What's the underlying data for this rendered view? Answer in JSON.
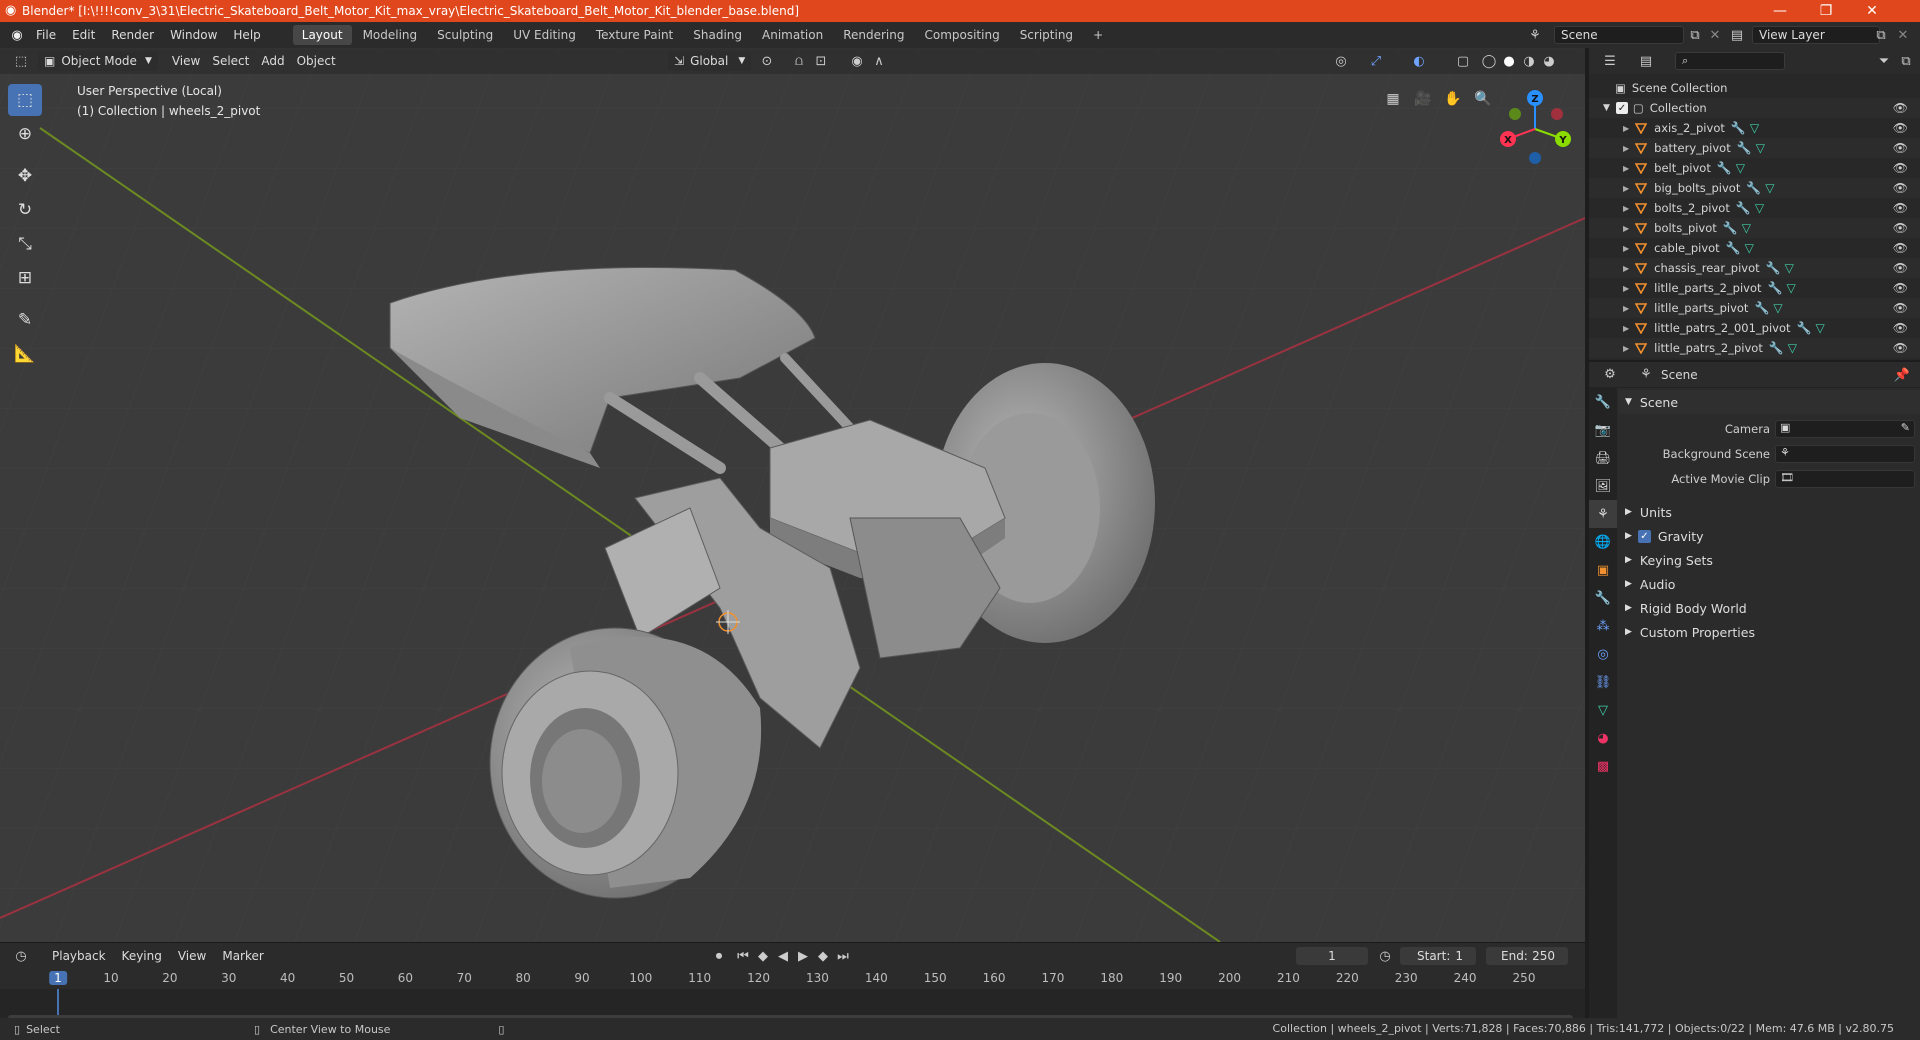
{
  "window": {
    "title": "Blender* [I:\\!!!!conv_3\\31\\Electric_Skateboard_Belt_Motor_Kit_max_vray\\Electric_Skateboard_Belt_Motor_Kit_blender_base.blend]",
    "minimize": "—",
    "maximize": "❐",
    "close": "✕"
  },
  "menu": [
    "File",
    "Edit",
    "Render",
    "Window",
    "Help"
  ],
  "workspaces": [
    "Layout",
    "Modeling",
    "Sculpting",
    "UV Editing",
    "Texture Paint",
    "Shading",
    "Animation",
    "Rendering",
    "Compositing",
    "Scripting"
  ],
  "workspace_add": "+",
  "scene_field": "Scene",
  "view_layer_field": "View Layer",
  "viewport": {
    "mode": "Object Mode",
    "header_menus": [
      "View",
      "Select",
      "Add",
      "Object"
    ],
    "transform_orientation": "Global",
    "info_line1": "User Perspective (Local)",
    "info_line2": "(1) Collection | wheels_2_pivot",
    "gizmo": {
      "z": "Z",
      "y": "Y",
      "x": "X"
    }
  },
  "outliner": {
    "root": "Scene Collection",
    "collection": "Collection",
    "items": [
      "axis_2_pivot",
      "battery_pivot",
      "belt_pivot",
      "big_bolts_pivot",
      "bolts_2_pivot",
      "bolts_pivot",
      "cable_pivot",
      "chassis_rear_pivot",
      "litlle_parts_2_pivot",
      "litlle_parts_pivot",
      "little_patrs_2_001_pivot",
      "little_patrs_2_pivot"
    ]
  },
  "properties": {
    "context": "Scene",
    "panel": "Scene",
    "fields": [
      {
        "label": "Camera"
      },
      {
        "label": "Background Scene"
      },
      {
        "label": "Active Movie Clip"
      }
    ],
    "subpanels": [
      "Units",
      "Gravity",
      "Keying Sets",
      "Audio",
      "Rigid Body World",
      "Custom Properties"
    ],
    "gravity_checked": true
  },
  "timeline": {
    "menus": [
      "Playback",
      "Keying",
      "View",
      "Marker"
    ],
    "current_frame": "1",
    "start_label": "Start:",
    "start": "1",
    "end_label": "End:",
    "end": "250",
    "ticks": [
      "1",
      "10",
      "20",
      "30",
      "40",
      "50",
      "60",
      "70",
      "80",
      "90",
      "100",
      "110",
      "120",
      "130",
      "140",
      "150",
      "160",
      "170",
      "180",
      "190",
      "200",
      "210",
      "220",
      "230",
      "240",
      "250"
    ]
  },
  "status": {
    "select": "Select",
    "center_view": "Center View to Mouse",
    "stats": "Collection | wheels_2_pivot | Verts:71,828 | Faces:70,886 | Tris:141,772 | Objects:0/22 | Mem: 47.6 MB | v2.80.75"
  },
  "colors": {
    "title_bar": "#e0471c",
    "accent_blue": "#4772b3",
    "axis_x": "#ff3352",
    "axis_y": "#8bdc00",
    "axis_z": "#2890ff",
    "object_orange": "#f2902f"
  }
}
